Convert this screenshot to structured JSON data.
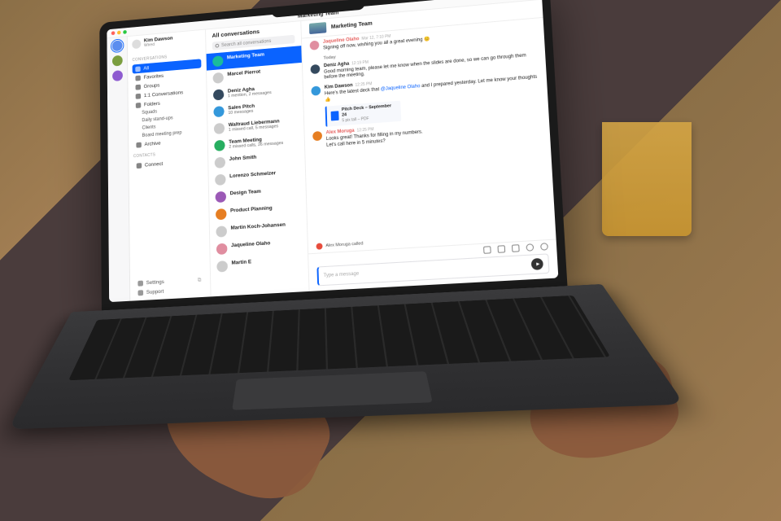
{
  "window": {
    "title": "Marketing Team"
  },
  "user": {
    "name": "Kim Dawson",
    "status": "Wired"
  },
  "sidebar": {
    "sections": {
      "conversations_label": "Conversations",
      "contacts_label": "Contacts"
    },
    "items": {
      "all": "All",
      "favorites": "Favorites",
      "groups": "Groups",
      "direct": "1:1 Conversations",
      "folders": "Folders",
      "archive": "Archive",
      "connect": "Connect"
    },
    "folders": {
      "squads": "Squads",
      "standups": "Daily stand-ups",
      "clients": "Clients",
      "boardprep": "Board meeting prep"
    },
    "footer": {
      "settings": "Settings",
      "support": "Support"
    }
  },
  "convlist": {
    "title": "All conversations",
    "search_placeholder": "Search all conversations",
    "items": [
      {
        "name": "Marketing Team",
        "sub": ""
      },
      {
        "name": "Marcel Pierrot",
        "sub": ""
      },
      {
        "name": "Deniz Agha",
        "sub": "1 mention, 2 messages"
      },
      {
        "name": "Sales Pitch",
        "sub": "10 messages"
      },
      {
        "name": "Waltraud Liebermann",
        "sub": "1 missed call, 5 messages"
      },
      {
        "name": "Team Meeting",
        "sub": "2 missed calls, 26 messages"
      },
      {
        "name": "John Smith",
        "sub": ""
      },
      {
        "name": "Lorenzo Schmelzer",
        "sub": ""
      },
      {
        "name": "Design Team",
        "sub": ""
      },
      {
        "name": "Product Planning",
        "sub": ""
      },
      {
        "name": "Martin Koch-Johansen",
        "sub": ""
      },
      {
        "name": "Jaqueline Olaho",
        "sub": ""
      },
      {
        "name": "Martin E",
        "sub": ""
      }
    ]
  },
  "chat": {
    "title": "Marketing Team",
    "messages": [
      {
        "author": "Jaqueline Olaho",
        "time": "Mar 12, 7:10 PM",
        "body": "Signing off now, wishing you all a great evening 😊",
        "system": true
      },
      {
        "divider": "Today"
      },
      {
        "author": "Deniz Agha",
        "time": "12:19 PM",
        "body": "Good morning team, please let me know when the slides are done, so we can go through them before the meeting."
      },
      {
        "author": "Kim Dawson",
        "time": "12:25 PM",
        "body": "Here's the latest deck that @Jaqueline Olaho and I prepared yesterday. Let me know your thoughts 👍",
        "attach": {
          "name": "Pitch Deck – September 24",
          "sub": "5 pix tall – PDF"
        }
      },
      {
        "author": "Alex Moruga",
        "time": "12:25 PM",
        "body": "Looks great! Thanks for filling in my numbers.",
        "body2": "Let's call here in 5 minutes?",
        "system": true
      }
    ],
    "call": "Alex Moruga called",
    "compose_placeholder": "Type a message"
  }
}
